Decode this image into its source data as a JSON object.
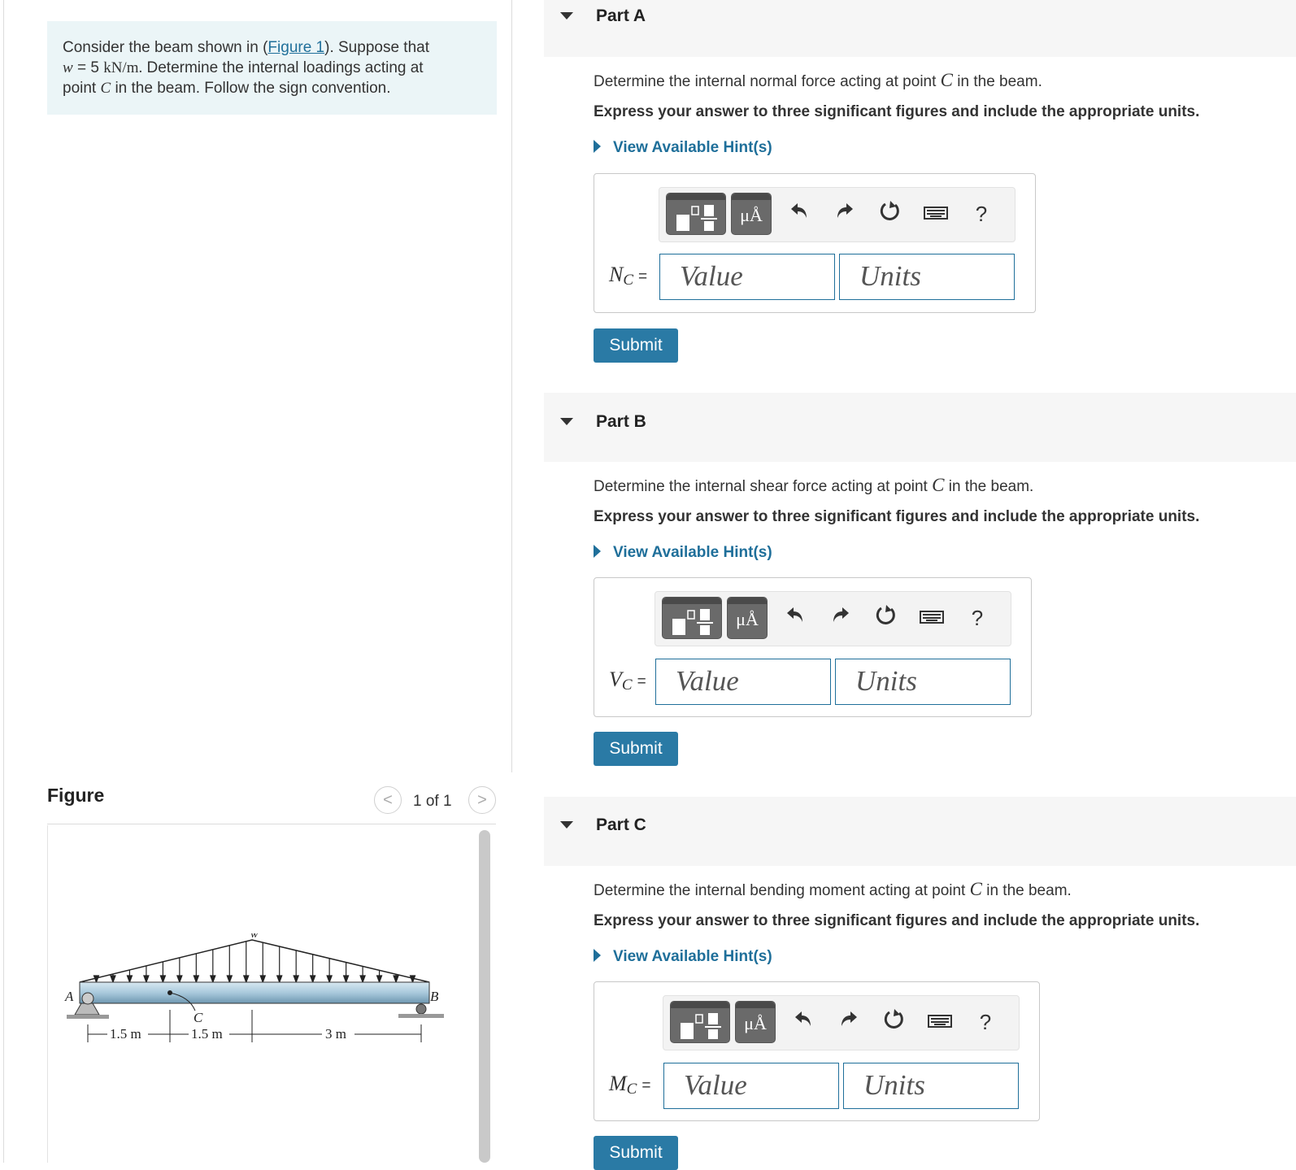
{
  "problem": {
    "intro": "Consider the beam shown in (",
    "figure_link": "Figure 1",
    "after_link": "). Suppose that",
    "w_var": "w",
    "w_eq": " = 5 ",
    "w_unit": "kN/m.",
    "sentence2": " Determine the internal loadings acting at",
    "point_word": "point ",
    "c_var": "C",
    "rest": " in the beam. Follow the sign convention."
  },
  "figure": {
    "title": "Figure",
    "pager_text": "1 of 1",
    "prev_glyph": "<",
    "next_glyph": ">",
    "labels": {
      "w": "w",
      "a": "A",
      "b": "B",
      "c": "C",
      "d1": "1.5 m",
      "d2": "1.5 m",
      "d3": "3 m"
    }
  },
  "parts": [
    {
      "title": "Part A",
      "question_pre": "Determine the internal normal force acting at point ",
      "question_var": "C",
      "question_post": " in the beam.",
      "express": "Express your answer to three significant figures and include the appropriate units.",
      "hint": "View Available Hint(s)",
      "var": "N",
      "sub": "C",
      "eq_sign": "=",
      "value_placeholder": "Value",
      "units_placeholder": "Units",
      "submit": "Submit"
    },
    {
      "title": "Part B",
      "question_pre": "Determine the internal shear force acting at point ",
      "question_var": "C",
      "question_post": " in the beam.",
      "express": "Express your answer to three significant figures and include the appropriate units.",
      "hint": "View Available Hint(s)",
      "var": "V",
      "sub": "C",
      "eq_sign": "=",
      "value_placeholder": "Value",
      "units_placeholder": "Units",
      "submit": "Submit"
    },
    {
      "title": "Part C",
      "question_pre": "Determine the internal bending moment acting at point ",
      "question_var": "C",
      "question_post": " in the beam.",
      "express": "Express your answer to three significant figures and include the appropriate units.",
      "hint": "View Available Hint(s)",
      "var": "M",
      "sub": "C",
      "eq_sign": "=",
      "value_placeholder": "Value",
      "units_placeholder": "Units",
      "submit": "Submit"
    }
  ],
  "toolbar": {
    "units_button": "μÅ",
    "help": "?",
    "undo_icon": "undo-icon",
    "redo_icon": "redo-icon",
    "reset_icon": "reset-icon",
    "keyboard_icon": "keyboard-icon"
  }
}
